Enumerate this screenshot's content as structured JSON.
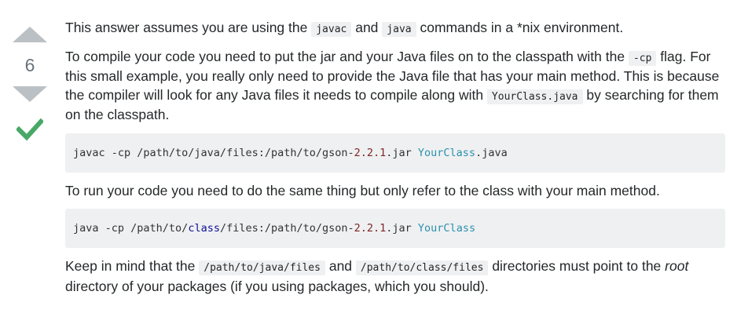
{
  "vote": {
    "count": "6",
    "upvote_icon": "triangle-up-icon",
    "downvote_icon": "triangle-down-icon",
    "accepted_icon": "checkmark-icon",
    "accepted_color": "#48a868",
    "arrow_color": "#bbc0c4"
  },
  "post": {
    "p1": {
      "t1": "This answer assumes you are using the ",
      "c1": "javac",
      "t2": " and ",
      "c2": "java",
      "t3": " commands in a *nix environment."
    },
    "p2": {
      "t1": "To compile your code you need to put the jar and your Java files on to the classpath with the ",
      "c1": "-cp",
      "t2": " flag. For this small example, you really only need to provide the Java file that has your main method. This is because the compiler will look for any Java files it needs to compile along with ",
      "c2": "YourClass.java",
      "t3": " by searching for them on the classpath."
    },
    "code1": {
      "a": "javac -cp /path/to/java/files:/path/to/gson-",
      "num": "2.2.1",
      "b": ".jar ",
      "cls": "YourClass",
      "c": ".java"
    },
    "p3": "To run your code you need to do the same thing but only refer to the class with your main method.",
    "code2": {
      "a": "java -cp /path/to/",
      "kw": "class",
      "b": "/files:/path/to/gson-",
      "num": "2.2.1",
      "c": ".jar ",
      "cls": "YourClass"
    },
    "p4": {
      "t1": "Keep in mind that the ",
      "c1": "/path/to/java/files",
      "t2": " and ",
      "c2": "/path/to/class/files",
      "t3": " directories must point to the ",
      "em": "root",
      "t4": " directory of your packages (if you using packages, which you should)."
    }
  }
}
